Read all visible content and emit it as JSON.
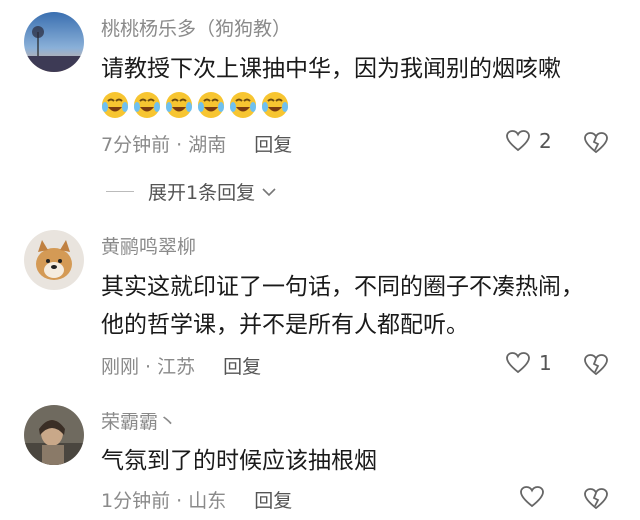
{
  "comments": [
    {
      "username": "桃桃杨乐多（狗狗教）",
      "lines": [
        "请教授下次上课抽中华，因为我闻别的烟咳嗽"
      ],
      "emoji": [
        "crying-laughing-face",
        "crying-laughing-face",
        "crying-laughing-face",
        "crying-laughing-face",
        "crying-laughing-face",
        "crying-laughing-face"
      ],
      "time_location": "7分钟前 · 湖南",
      "reply_label": "回复",
      "likes": "2",
      "expand_label": "展开1条回复"
    },
    {
      "username": "黄鹂鸣翠柳",
      "lines": [
        "其实这就印证了一句话，不同的圈子不凑热闹，",
        "他的哲学课，并不是所有人都配听。"
      ],
      "time_location": "刚刚 · 江苏",
      "reply_label": "回复",
      "likes": "1"
    },
    {
      "username": "荣霸霸丶",
      "lines": [
        "气氛到了的时候应该抽根烟"
      ],
      "time_location": "1分钟前 · 山东",
      "reply_label": "回复",
      "likes": ""
    }
  ],
  "colors": {
    "meta": "#8a8a8a",
    "text": "#1a1a1a",
    "emoji": "#f7c531"
  }
}
